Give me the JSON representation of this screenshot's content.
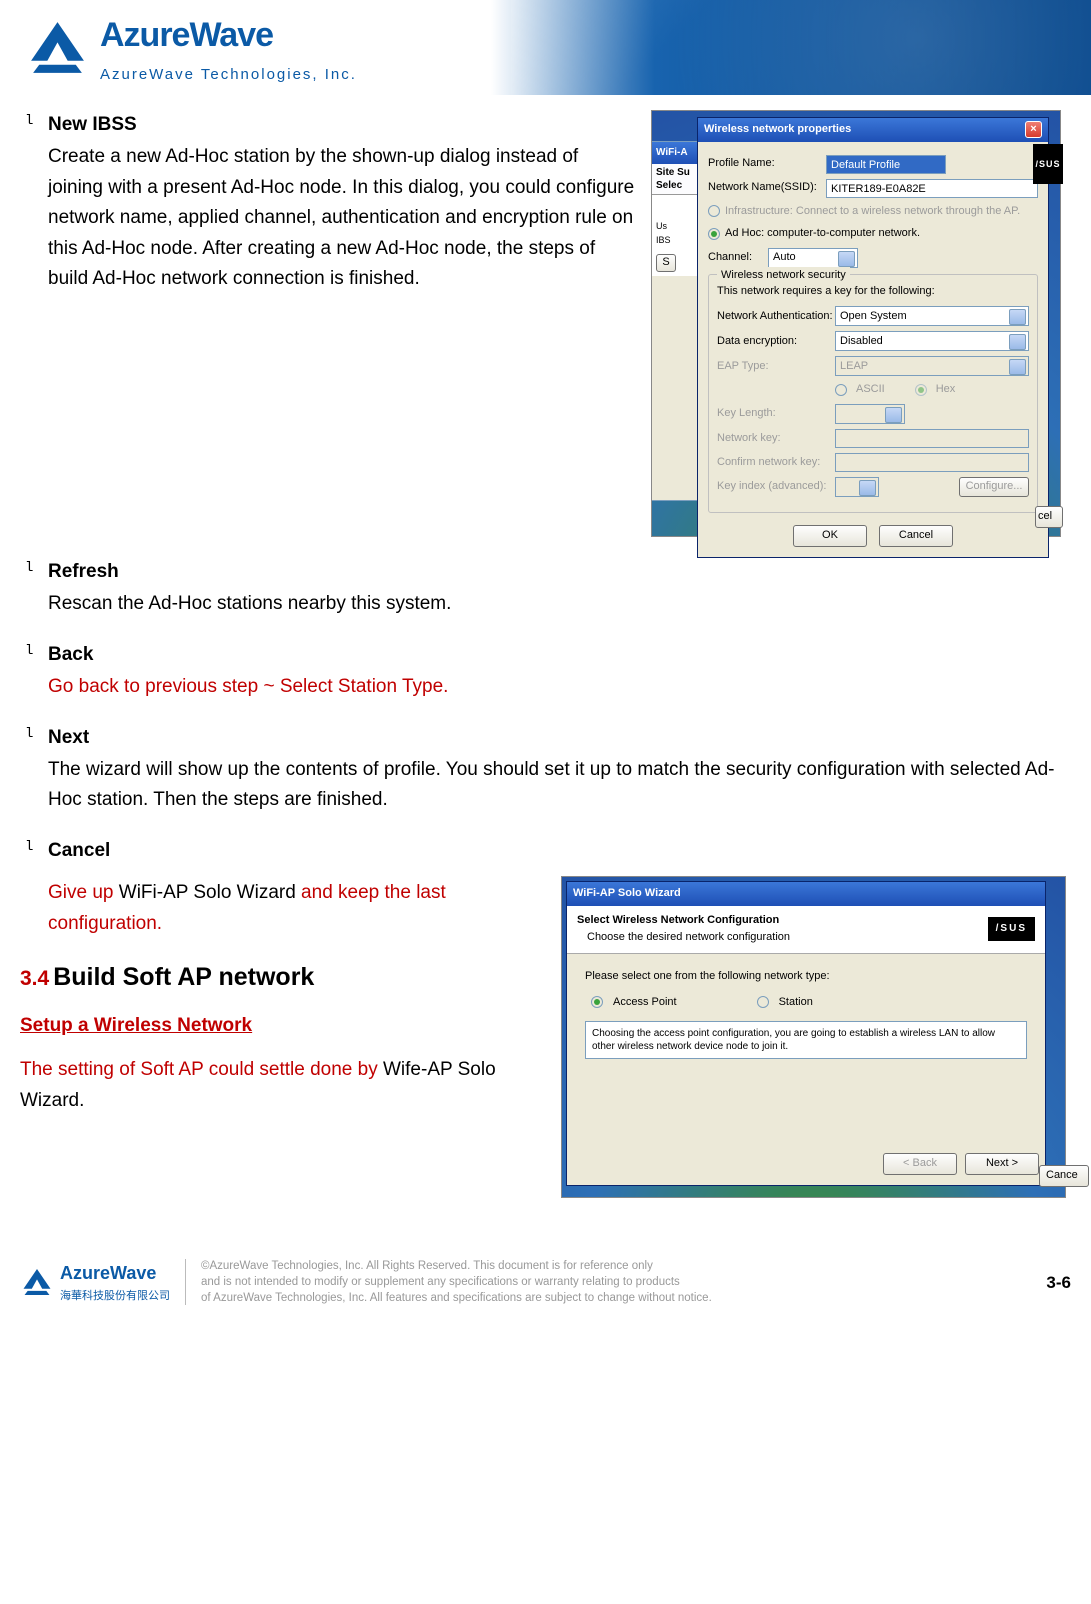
{
  "header": {
    "brand_name": "AzureWave",
    "brand_sub": "AzureWave  Technologies,  Inc."
  },
  "items": {
    "new_ibss": {
      "title": "New IBSS",
      "body": "Create a new Ad-Hoc station by the shown-up dialog instead of joining with a present Ad-Hoc node. In this dialog, you could configure network name, applied channel, authentication and encryption rule on this Ad-Hoc node. After creating a new Ad-Hoc node, the steps of build Ad-Hoc network connection is finished."
    },
    "refresh": {
      "title": "Refresh",
      "body": "Rescan the Ad-Hoc stations nearby this system."
    },
    "back": {
      "title": "Back",
      "body_red": "Go back to previous step ~ Select Station Type."
    },
    "next": {
      "title": "Next",
      "body": "The wizard will show up the contents of profile. You should set it up to match the security configuration with selected Ad-Hoc station. Then the steps are finished."
    },
    "cancel": {
      "title": "Cancel",
      "body_red1": "Give up ",
      "body_black": "WiFi-AP Solo Wizard",
      "body_red2": " and keep the last configuration."
    }
  },
  "section": {
    "number": "3.4",
    "title": "Build Soft AP network",
    "sub_heading": "Setup a Wireless Network",
    "body_red": "The setting of Soft AP could settle done by ",
    "body_black": "Wife-AP Solo Wizard."
  },
  "dialog1": {
    "back_title": "WiFi-A",
    "back_tabs_line1": "Site Su",
    "back_tabs_line2": "Selec",
    "back_body_line1": "Us",
    "back_body_line2": "IBS",
    "back_body_btn": "S",
    "title": "Wireless network properties",
    "profile_label": "Profile Name:",
    "profile_value": "Default Profile",
    "ssid_label": "Network Name(SSID):",
    "ssid_value": "KITER189-E0A82E",
    "infra_label": "Infrastructure: Connect to a wireless network through the AP.",
    "adhoc_label": "Ad Hoc: computer-to-computer network.",
    "channel_label": "Channel:",
    "channel_value": "Auto",
    "group_title": "Wireless network security",
    "group_desc": "This network requires a key for the following:",
    "auth_label": "Network Authentication:",
    "auth_value": "Open System",
    "enc_label": "Data encryption:",
    "enc_value": "Disabled",
    "eap_label": "EAP Type:",
    "eap_value": "LEAP",
    "ascii_label": "ASCII",
    "hex_label": "Hex",
    "keylen_label": "Key Length:",
    "netkey_label": "Network key:",
    "confkey_label": "Confirm network key:",
    "keyidx_label": "Key index (advanced):",
    "configure_btn": "Configure...",
    "ok_btn": "OK",
    "cancel_btn": "Cancel",
    "asus": "/SUS",
    "outer_cancel": "cel"
  },
  "dialog2": {
    "title": "WiFi-AP Solo Wizard",
    "header_line1": "Select Wireless Network Configuration",
    "header_line2": "Choose the desired network configuration",
    "asus": "/SUS",
    "prompt": "Please select one from the following network type:",
    "opt_ap": "Access Point",
    "opt_station": "Station",
    "desc": "Choosing the access point configuration, you are going to establish a wireless LAN to allow other wireless network device node to join it.",
    "back_btn": "< Back",
    "next_btn": "Next >",
    "cancel_btn": "Cance"
  },
  "footer": {
    "brand_name": "AzureWave",
    "brand_sub": "海華科技股份有限公司",
    "copyright_l1": "©AzureWave Technologies, Inc. All Rights Reserved. This document is for reference only",
    "copyright_l2": "and is not intended to modify or supplement any specifications or  warranty relating to products",
    "copyright_l3": "of AzureWave Technologies, Inc.  All features and specifications are subject to change without notice.",
    "page": "3-6"
  }
}
